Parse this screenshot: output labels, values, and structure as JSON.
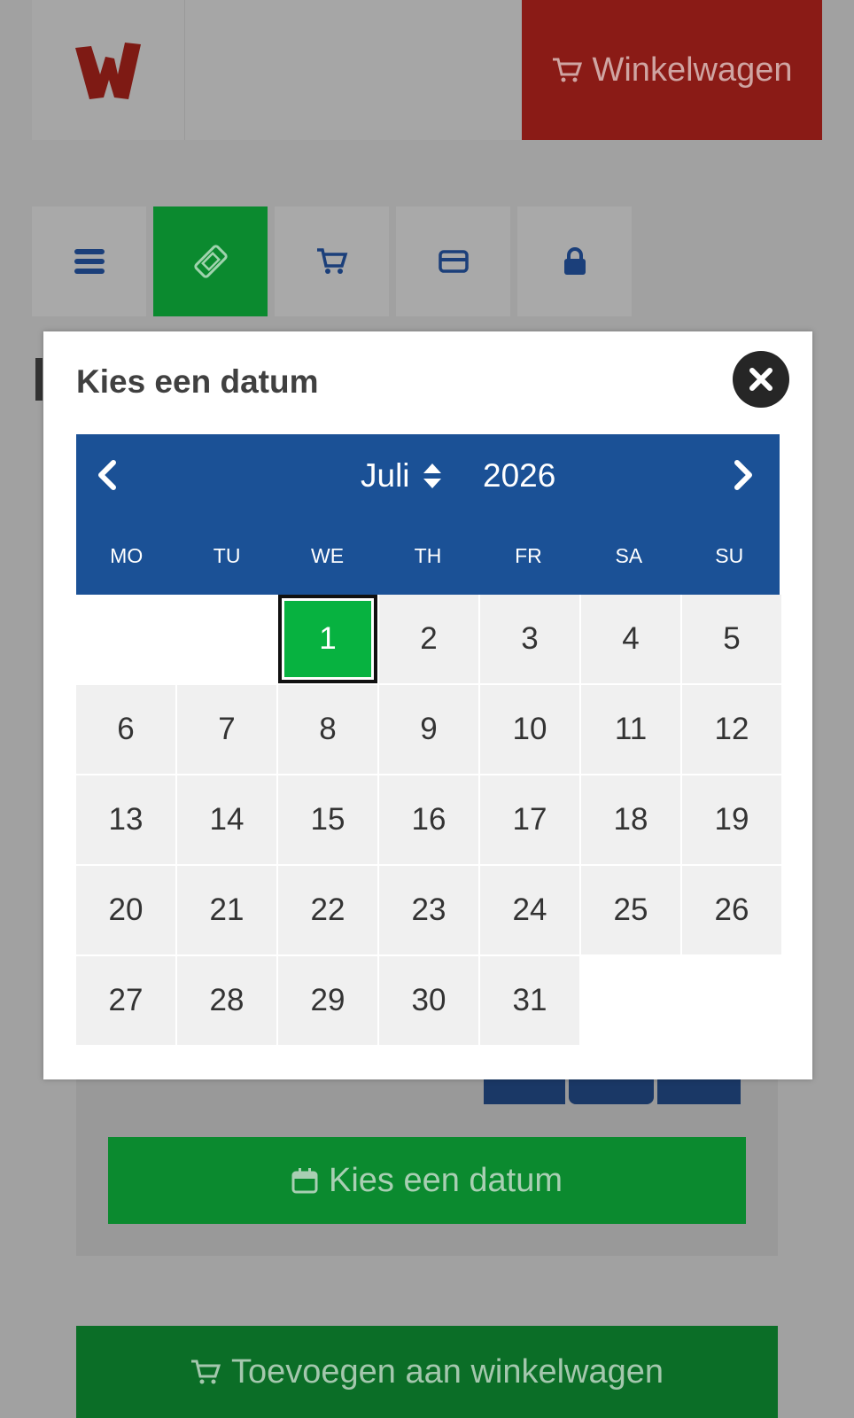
{
  "header": {
    "cart_label": "Winkelwagen"
  },
  "steps": [
    "menu-icon",
    "ticket-icon",
    "cart-icon",
    "card-icon",
    "lock-icon"
  ],
  "page": {
    "date_button_label": "Kies een datum",
    "add_to_cart_label": "Toevoegen aan winkelwagen"
  },
  "modal": {
    "title": "Kies een datum",
    "month": "Juli",
    "year": "2026",
    "weekdays": [
      "MO",
      "TU",
      "WE",
      "TH",
      "FR",
      "SA",
      "SU"
    ],
    "days": [
      "",
      "",
      "1",
      "2",
      "3",
      "4",
      "5",
      "6",
      "7",
      "8",
      "9",
      "10",
      "11",
      "12",
      "13",
      "14",
      "15",
      "16",
      "17",
      "18",
      "19",
      "20",
      "21",
      "22",
      "23",
      "24",
      "25",
      "26",
      "27",
      "28",
      "29",
      "30",
      "31",
      "",
      ""
    ],
    "selected_day": "1"
  },
  "colors": {
    "brand_red": "#8a1b16",
    "calendar_blue": "#1b5196",
    "selected_green": "#07b240",
    "button_green": "#0b8a2f"
  }
}
